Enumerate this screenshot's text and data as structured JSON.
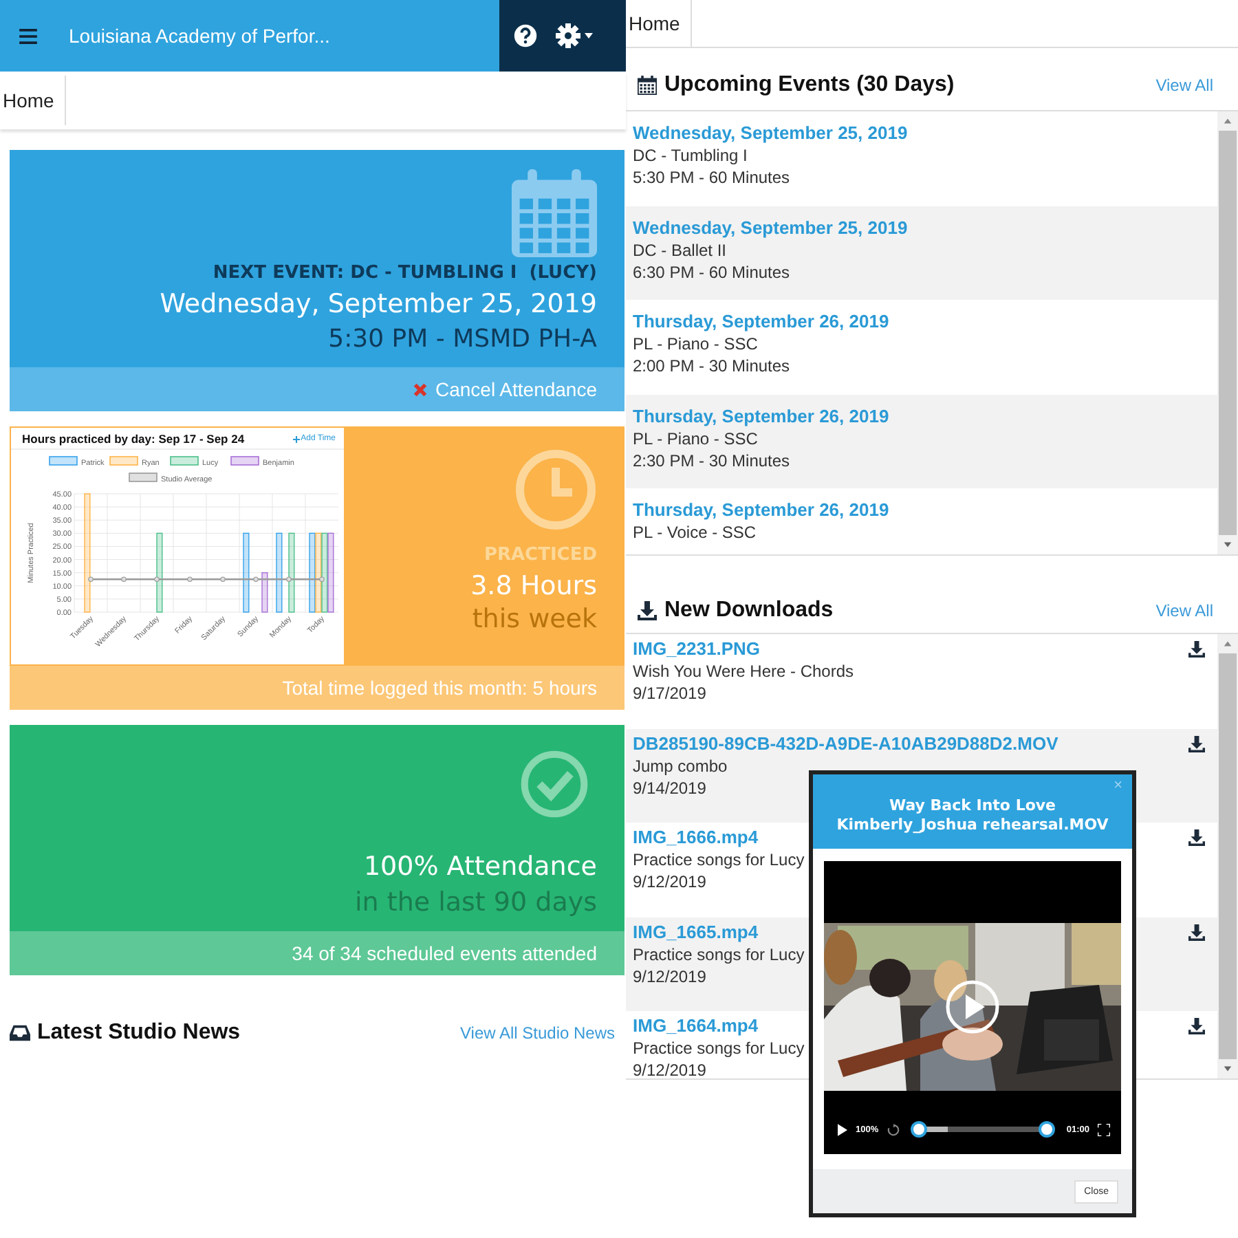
{
  "header": {
    "title": "Louisiana Academy of Perfor..."
  },
  "left_breadcrumb": {
    "label": "Home"
  },
  "next_event": {
    "label": "NEXT EVENT: DC - TUMBLING I  (LUCY)",
    "date": "Wednesday, September 25, 2019",
    "time": "5:30 PM - MSMD PH-A",
    "action": "Cancel Attendance"
  },
  "practice": {
    "chart_title": "Hours practiced by day: Sep 17 - Sep 24",
    "add_time": "Add Time",
    "chart_data": {
      "type": "bar",
      "ylabel": "Minutes Practiced",
      "categories": [
        "Tuesday",
        "Wednesday",
        "Thursday",
        "Friday",
        "Saturday",
        "Sunday",
        "Monday",
        "Today"
      ],
      "ylim": [
        0,
        45
      ],
      "grid": true,
      "legend": "top",
      "yticks": [
        {
          "value": 0,
          "label": "0.00"
        },
        {
          "value": 5,
          "label": "5.00"
        },
        {
          "value": 10,
          "label": "10.00"
        },
        {
          "value": 15,
          "label": "15.00"
        },
        {
          "value": 20,
          "label": "20.00"
        },
        {
          "value": 25,
          "label": "25.00"
        },
        {
          "value": 30,
          "label": "30.00"
        },
        {
          "value": 35,
          "label": "35.00"
        },
        {
          "value": 40,
          "label": "40.00"
        },
        {
          "value": 45,
          "label": "45.00"
        }
      ],
      "series": [
        {
          "name": "Patrick",
          "color": "#36a2eb",
          "values": [
            0,
            0,
            0,
            0,
            0,
            30,
            30,
            30
          ]
        },
        {
          "name": "Ryan",
          "color": "#ffb347",
          "values": [
            45,
            0,
            0,
            0,
            0,
            0,
            0,
            30
          ]
        },
        {
          "name": "Lucy",
          "color": "#4bc08a",
          "values": [
            0,
            0,
            30,
            0,
            0,
            0,
            30,
            30
          ]
        },
        {
          "name": "Benjamin",
          "color": "#a86fd6",
          "values": [
            0,
            0,
            0,
            0,
            0,
            15,
            0,
            30
          ]
        },
        {
          "name": "Studio Average",
          "color": "#999999",
          "type": "line",
          "marker": "circle",
          "values": [
            12.5,
            12.5,
            12.5,
            12.5,
            12.5,
            12.5,
            12.5,
            12.5
          ]
        }
      ]
    },
    "label": "PRACTICED",
    "hours": "3.8 Hours",
    "period": "this week",
    "footer": "Total time logged this month: 5 hours"
  },
  "attendance": {
    "percent": "100% Attendance",
    "period": "in the last 90 days",
    "footer": "34 of 34 scheduled events attended"
  },
  "news": {
    "title": "Latest Studio News",
    "link": "View All Studio News"
  },
  "right_breadcrumb": {
    "label": "Home"
  },
  "upcoming": {
    "title": "Upcoming Events (30 Days)",
    "link": "View All",
    "events": [
      {
        "date": "Wednesday, September 25, 2019",
        "name": "DC - Tumbling I",
        "time": "5:30 PM - 60 Minutes"
      },
      {
        "date": "Wednesday, September 25, 2019",
        "name": "DC - Ballet II",
        "time": "6:30 PM - 60 Minutes"
      },
      {
        "date": "Thursday, September 26, 2019",
        "name": "PL - Piano - SSC",
        "time": "2:00 PM - 30 Minutes"
      },
      {
        "date": "Thursday, September 26, 2019",
        "name": "PL - Piano - SSC",
        "time": "2:30 PM - 30 Minutes"
      },
      {
        "date": "Thursday, September 26, 2019",
        "name": "PL - Voice - SSC"
      }
    ]
  },
  "downloads": {
    "title": "New Downloads",
    "link": "View All",
    "items": [
      {
        "file": "IMG_2231.PNG",
        "description": "Wish You Were Here - Chords",
        "date": "9/17/2019"
      },
      {
        "file": "DB285190-89CB-432D-A9DE-A10AB29D88D2.MOV",
        "description": "Jump combo",
        "date": "9/14/2019"
      },
      {
        "file": "IMG_1666.mp4",
        "description": "Practice songs for Lucy",
        "date": "9/12/2019"
      },
      {
        "file": "IMG_1665.mp4",
        "description": "Practice songs for Lucy",
        "date": "9/12/2019"
      },
      {
        "file": "IMG_1664.mp4",
        "description": "Practice songs for Lucy",
        "date": "9/12/2019"
      }
    ]
  },
  "video_dialog": {
    "title_lines": [
      "Way Back Into Love",
      "Kimberly_Joshua rehearsal.MOV"
    ],
    "close_glyph": "×",
    "zoom": "100%",
    "progress": {
      "level": 0.0
    },
    "time": "01:00",
    "close": "Close"
  }
}
